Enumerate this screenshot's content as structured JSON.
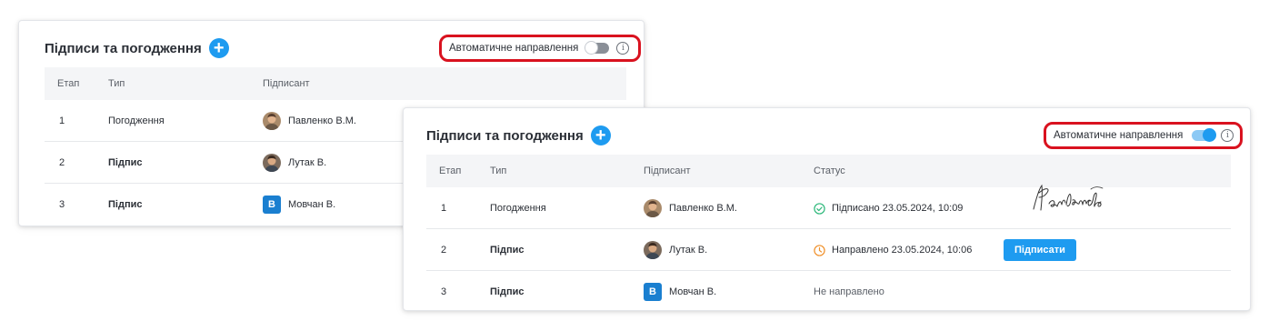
{
  "back_panel": {
    "title": "Підписи та погодження",
    "add_label": "+",
    "auto_route_label": "Автоматичне направлення",
    "auto_route_enabled": false,
    "info_label": "i",
    "columns": [
      "Етап",
      "Тип",
      "Підписант"
    ],
    "rows": [
      {
        "stage": "1",
        "type": "Погодження",
        "signer": "Павленко В.М.",
        "avatar": "photo"
      },
      {
        "stage": "2",
        "type": "Підпис",
        "signer": "Лутак В.",
        "avatar": "photo"
      },
      {
        "stage": "3",
        "type": "Підпис",
        "signer": "Мовчан В.",
        "avatar": "initial",
        "initial": "В"
      }
    ]
  },
  "front_panel": {
    "title": "Підписи та погодження",
    "add_label": "+",
    "auto_route_label": "Автоматичне направлення",
    "auto_route_enabled": true,
    "info_label": "i",
    "columns": [
      "Етап",
      "Тип",
      "Підписант",
      "Статус"
    ],
    "rows": [
      {
        "stage": "1",
        "type": "Погодження",
        "signer": "Павленко В.М.",
        "avatar": "photo",
        "status": "Підписано 23.05.2024, 10:09",
        "status_icon": "check-circle-icon",
        "signature": "Павленко"
      },
      {
        "stage": "2",
        "type": "Підпис",
        "signer": "Лутак В.",
        "avatar": "photo",
        "status": "Направлено 23.05.2024, 10:06",
        "status_icon": "clock-icon",
        "action": "Підписати"
      },
      {
        "stage": "3",
        "type": "Підпис",
        "signer": "Мовчан В.",
        "avatar": "initial",
        "initial": "В",
        "status": "Не направлено"
      }
    ]
  },
  "colors": {
    "accent": "#1e9bf0",
    "highlight": "#d9121f",
    "signed": "#2db87a",
    "pending": "#f0902a"
  }
}
